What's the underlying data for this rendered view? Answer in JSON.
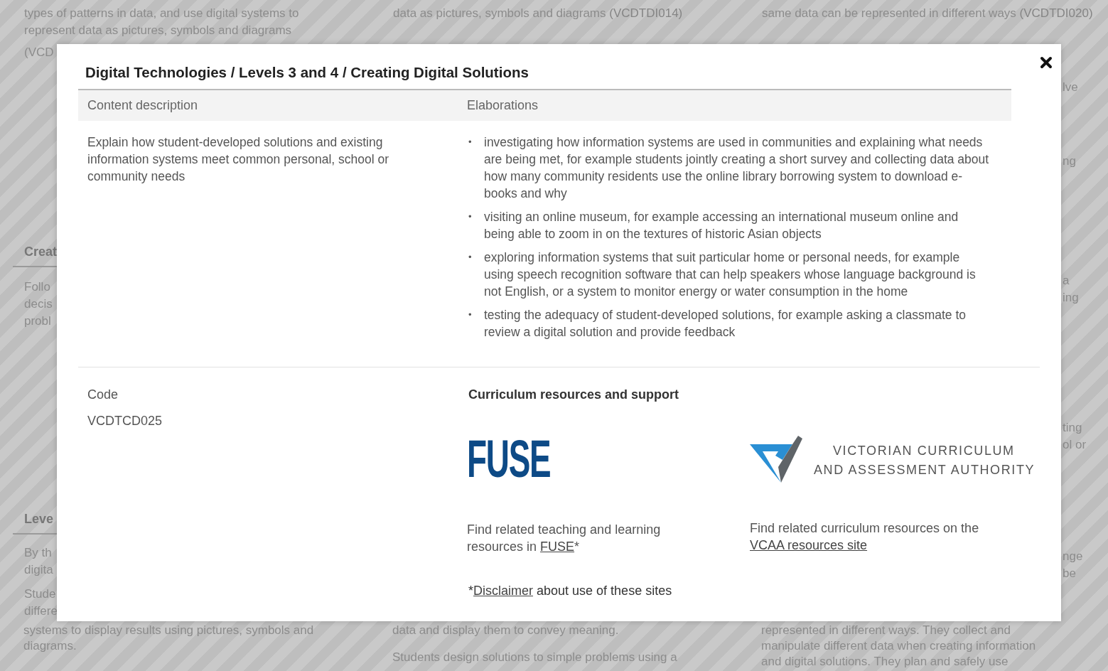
{
  "background": {
    "top_row": [
      {
        "lines": [
          "types of patterns in data, and use digital systems to",
          "represent data as pictures, symbols and diagrams"
        ]
      },
      {
        "lines": [
          "data as pictures, symbols and diagrams"
        ],
        "code": "(VCDTDI014)"
      },
      {
        "lines": [
          "same data can be represented in different ways"
        ],
        "code": "(VCDTDI020)"
      }
    ],
    "left_fragments": [
      {
        "kind": "text",
        "lines": [
          "(VCD"
        ]
      },
      {
        "kind": "heading",
        "lines": [
          "Creat"
        ]
      },
      {
        "kind": "text",
        "lines": [
          "Follo",
          "decis",
          "probl"
        ]
      },
      {
        "kind": "heading",
        "lines": [
          "Leve"
        ]
      },
      {
        "kind": "text",
        "lines": [
          "By th",
          "digita"
        ]
      },
      {
        "kind": "text",
        "lines": [
          "Stude",
          "differe"
        ]
      }
    ],
    "right_fragments": [
      {
        "lines": [
          "lve"
        ]
      },
      {
        "lines": [
          "ng"
        ]
      },
      {
        "lines": [
          "a",
          "ing"
        ]
      },
      {
        "lines": [
          "ting",
          "ol or"
        ]
      },
      {
        "lines": [
          "nge",
          "be"
        ]
      }
    ],
    "bottom_row": [
      {
        "paragraphs": [
          [
            "systems to display results using pictures, symbols and",
            "diagrams."
          ]
        ]
      },
      {
        "paragraphs": [
          [
            "data and display them to convey meaning."
          ],
          [
            "Students design solutions to simple problems using a"
          ]
        ]
      },
      {
        "paragraphs": [
          [
            "represented in different ways. They collect and",
            "manipulate different data when creating information",
            "and digital solutions. They plan and safely use"
          ]
        ]
      }
    ]
  },
  "modal": {
    "title": "Digital Technologies / Levels 3 and 4 / Creating Digital Solutions",
    "columns": [
      "Content description",
      "Elaborations"
    ],
    "content_description": "Explain how student-developed solutions and existing information systems meet common personal, school or community needs",
    "bullet": "•",
    "elaborations": [
      "investigating how information systems are used in communities and explaining what needs are being met, for example students jointly creating a short survey and collecting data about how many community residents use the online library borrowing system to download e-books and why",
      "visiting an online museum, for example accessing an international museum online and being able to zoom in on the textures of historic Asian objects",
      "exploring information systems that suit particular home or personal needs, for example using speech recognition software that can help speakers whose language background is not English, or a system to monitor energy or water consumption in the home",
      "testing the adequacy of student-developed solutions, for example asking a classmate to review a digital solution and provide feedback"
    ],
    "code_label": "Code",
    "code": "VCDTCD025",
    "resources_heading": "Curriculum resources and support",
    "fuse": {
      "logo": "FUSE",
      "text": "Find related teaching and learning resources in ",
      "link": "FUSE",
      "suffix": "*"
    },
    "vcaa": {
      "logo_lines": [
        "VICTORIAN CURRICULUM",
        "AND ASSESSMENT AUTHORITY"
      ],
      "text": "Find related curriculum resources on the ",
      "link": "VCAA resources site"
    },
    "disclaimer": {
      "prefix": "*",
      "link": "Disclaimer",
      "text": " about use of these sites"
    }
  }
}
